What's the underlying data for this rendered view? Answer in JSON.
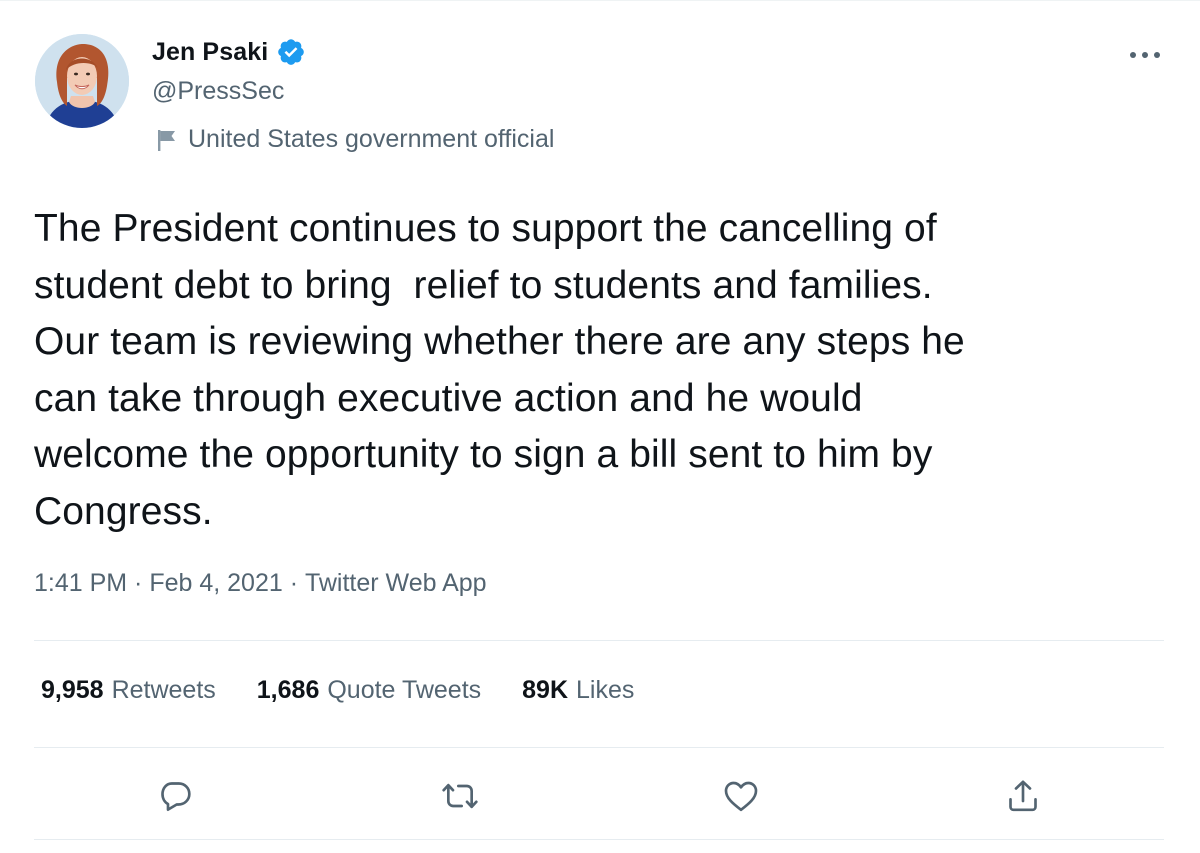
{
  "author": {
    "display_name": "Jen Psaki",
    "handle": "@PressSec",
    "verified": true,
    "label": "United States government official",
    "avatar_icon": "profile-photo",
    "verified_icon": "verified-badge-icon",
    "label_icon": "flag-icon"
  },
  "tweet": {
    "text": "The President continues to support the cancelling of\nstudent debt to bring  relief to students and families.\nOur team is reviewing whether there are any steps he\ncan take through executive action and he would\nwelcome the opportunity to sign a bill sent to him by\nCongress.",
    "time": "1:41 PM",
    "separator": " · ",
    "date": "Feb 4, 2021",
    "source": "Twitter Web App"
  },
  "stats": {
    "retweets_count": "9,958",
    "retweets_label": "Retweets",
    "quotes_count": "1,686",
    "quotes_label": "Quote Tweets",
    "likes_count": "89K",
    "likes_label": "Likes"
  },
  "actions": [
    "reply-icon",
    "retweet-icon",
    "like-icon",
    "share-icon"
  ],
  "colors": {
    "text_primary": "#0f1419",
    "text_secondary": "#536471",
    "verified_blue": "#1d9bf0",
    "divider": "#e6ecf0"
  }
}
